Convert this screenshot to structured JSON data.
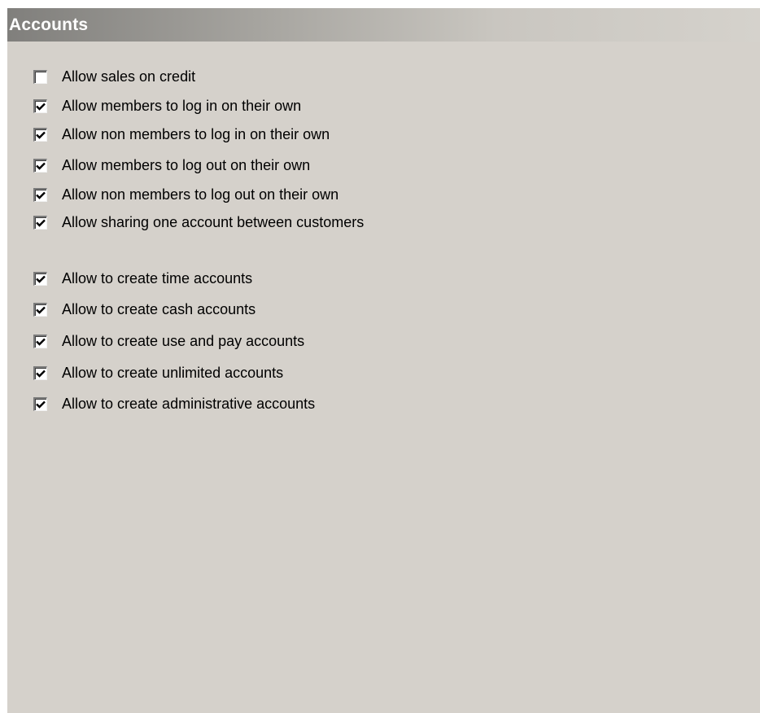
{
  "panel": {
    "title": "Accounts"
  },
  "options": [
    {
      "label": "Allow sales on credit",
      "checked": false
    },
    {
      "label": "Allow members to log in on their own",
      "checked": true
    },
    {
      "label": "Allow non members to log in on their own",
      "checked": true
    },
    {
      "label": "Allow members to log out on their own",
      "checked": true
    },
    {
      "label": "Allow non members to log out on their own",
      "checked": true
    },
    {
      "label": "Allow sharing one account between customers",
      "checked": true
    },
    {
      "label": "Allow to create time accounts",
      "checked": true
    },
    {
      "label": "Allow to create cash accounts",
      "checked": true
    },
    {
      "label": "Allow to create use and pay accounts",
      "checked": true
    },
    {
      "label": "Allow to create unlimited accounts",
      "checked": true
    },
    {
      "label": "Allow to create administrative accounts",
      "checked": true
    }
  ]
}
